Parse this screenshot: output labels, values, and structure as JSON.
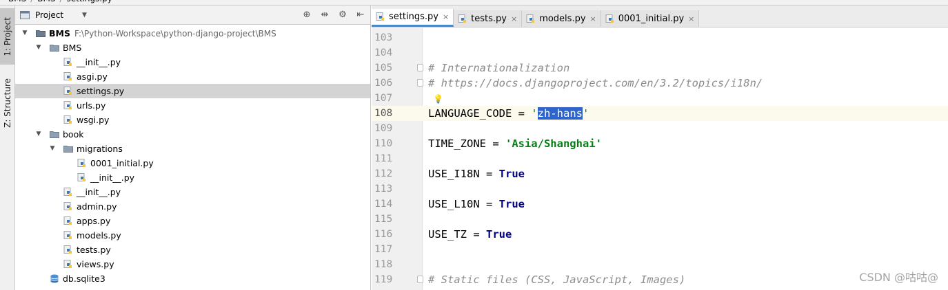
{
  "breadcrumb": {
    "items": [
      "BMS",
      "BMS",
      "settings.py"
    ]
  },
  "tool_strip": {
    "project_label": "1: Project",
    "structure_label": "Z: Structure"
  },
  "project_panel": {
    "title": "Project",
    "tools": [
      "⊕",
      "⇹",
      "⚙",
      "⇤"
    ]
  },
  "tree": [
    {
      "label": "BMS",
      "path": "F:\\Python-Workspace\\python-django-project\\BMS",
      "type": "root",
      "depth": 0,
      "expanded": true
    },
    {
      "label": "BMS",
      "type": "folder",
      "depth": 1,
      "expanded": true
    },
    {
      "label": "__init__.py",
      "type": "py",
      "depth": 2
    },
    {
      "label": "asgi.py",
      "type": "py",
      "depth": 2
    },
    {
      "label": "settings.py",
      "type": "py",
      "depth": 2,
      "selected": true
    },
    {
      "label": "urls.py",
      "type": "py",
      "depth": 2
    },
    {
      "label": "wsgi.py",
      "type": "py",
      "depth": 2
    },
    {
      "label": "book",
      "type": "folder",
      "depth": 1,
      "expanded": true
    },
    {
      "label": "migrations",
      "type": "folder",
      "depth": 2,
      "expanded": true
    },
    {
      "label": "0001_initial.py",
      "type": "py",
      "depth": 3
    },
    {
      "label": "__init__.py",
      "type": "py",
      "depth": 3
    },
    {
      "label": "__init__.py",
      "type": "py",
      "depth": 2
    },
    {
      "label": "admin.py",
      "type": "py",
      "depth": 2
    },
    {
      "label": "apps.py",
      "type": "py",
      "depth": 2
    },
    {
      "label": "models.py",
      "type": "py",
      "depth": 2
    },
    {
      "label": "tests.py",
      "type": "py",
      "depth": 2
    },
    {
      "label": "views.py",
      "type": "py",
      "depth": 2
    },
    {
      "label": "db.sqlite3",
      "type": "db",
      "depth": 1
    }
  ],
  "tabs": [
    {
      "label": "settings.py",
      "active": true
    },
    {
      "label": "tests.py",
      "active": false
    },
    {
      "label": "models.py",
      "active": false
    },
    {
      "label": "0001_initial.py",
      "active": false
    }
  ],
  "editor": {
    "lines": [
      {
        "num": "103",
        "parts": []
      },
      {
        "num": "104",
        "parts": []
      },
      {
        "num": "105",
        "fold": true,
        "parts": [
          {
            "t": "# Internationalization",
            "c": "comment"
          }
        ]
      },
      {
        "num": "106",
        "fold": true,
        "parts": [
          {
            "t": "# https://docs.djangoproject.com/en/3.2/topics/i18n/",
            "c": "comment"
          }
        ]
      },
      {
        "num": "107",
        "bulb": true,
        "parts": []
      },
      {
        "num": "108",
        "current": true,
        "parts": [
          {
            "t": "LANGUAGE_CODE = ",
            "c": ""
          },
          {
            "t": "'",
            "c": "q"
          },
          {
            "t": "zh-hans",
            "c": "sel"
          },
          {
            "t": "'",
            "c": "q"
          }
        ]
      },
      {
        "num": "109",
        "parts": []
      },
      {
        "num": "110",
        "parts": [
          {
            "t": "TIME_ZONE = ",
            "c": ""
          },
          {
            "t": "'Asia/Shanghai'",
            "c": "str"
          }
        ]
      },
      {
        "num": "111",
        "parts": []
      },
      {
        "num": "112",
        "parts": [
          {
            "t": "USE_I18N = ",
            "c": ""
          },
          {
            "t": "True",
            "c": "kw"
          }
        ]
      },
      {
        "num": "113",
        "parts": []
      },
      {
        "num": "114",
        "parts": [
          {
            "t": "USE_L10N = ",
            "c": ""
          },
          {
            "t": "True",
            "c": "kw"
          }
        ]
      },
      {
        "num": "115",
        "parts": []
      },
      {
        "num": "116",
        "parts": [
          {
            "t": "USE_TZ = ",
            "c": ""
          },
          {
            "t": "True",
            "c": "kw"
          }
        ]
      },
      {
        "num": "117",
        "parts": []
      },
      {
        "num": "118",
        "parts": []
      },
      {
        "num": "119",
        "fold": true,
        "parts": [
          {
            "t": "# Static files (CSS, JavaScript, Images)",
            "c": "comment"
          }
        ]
      }
    ]
  },
  "watermark": "CSDN @咕咕@",
  "colors": {
    "selection": "#2f65ca",
    "string": "#067d17",
    "keyword": "#000080",
    "comment": "#8c8c8c",
    "active_tab_underline": "#4a88c7"
  }
}
